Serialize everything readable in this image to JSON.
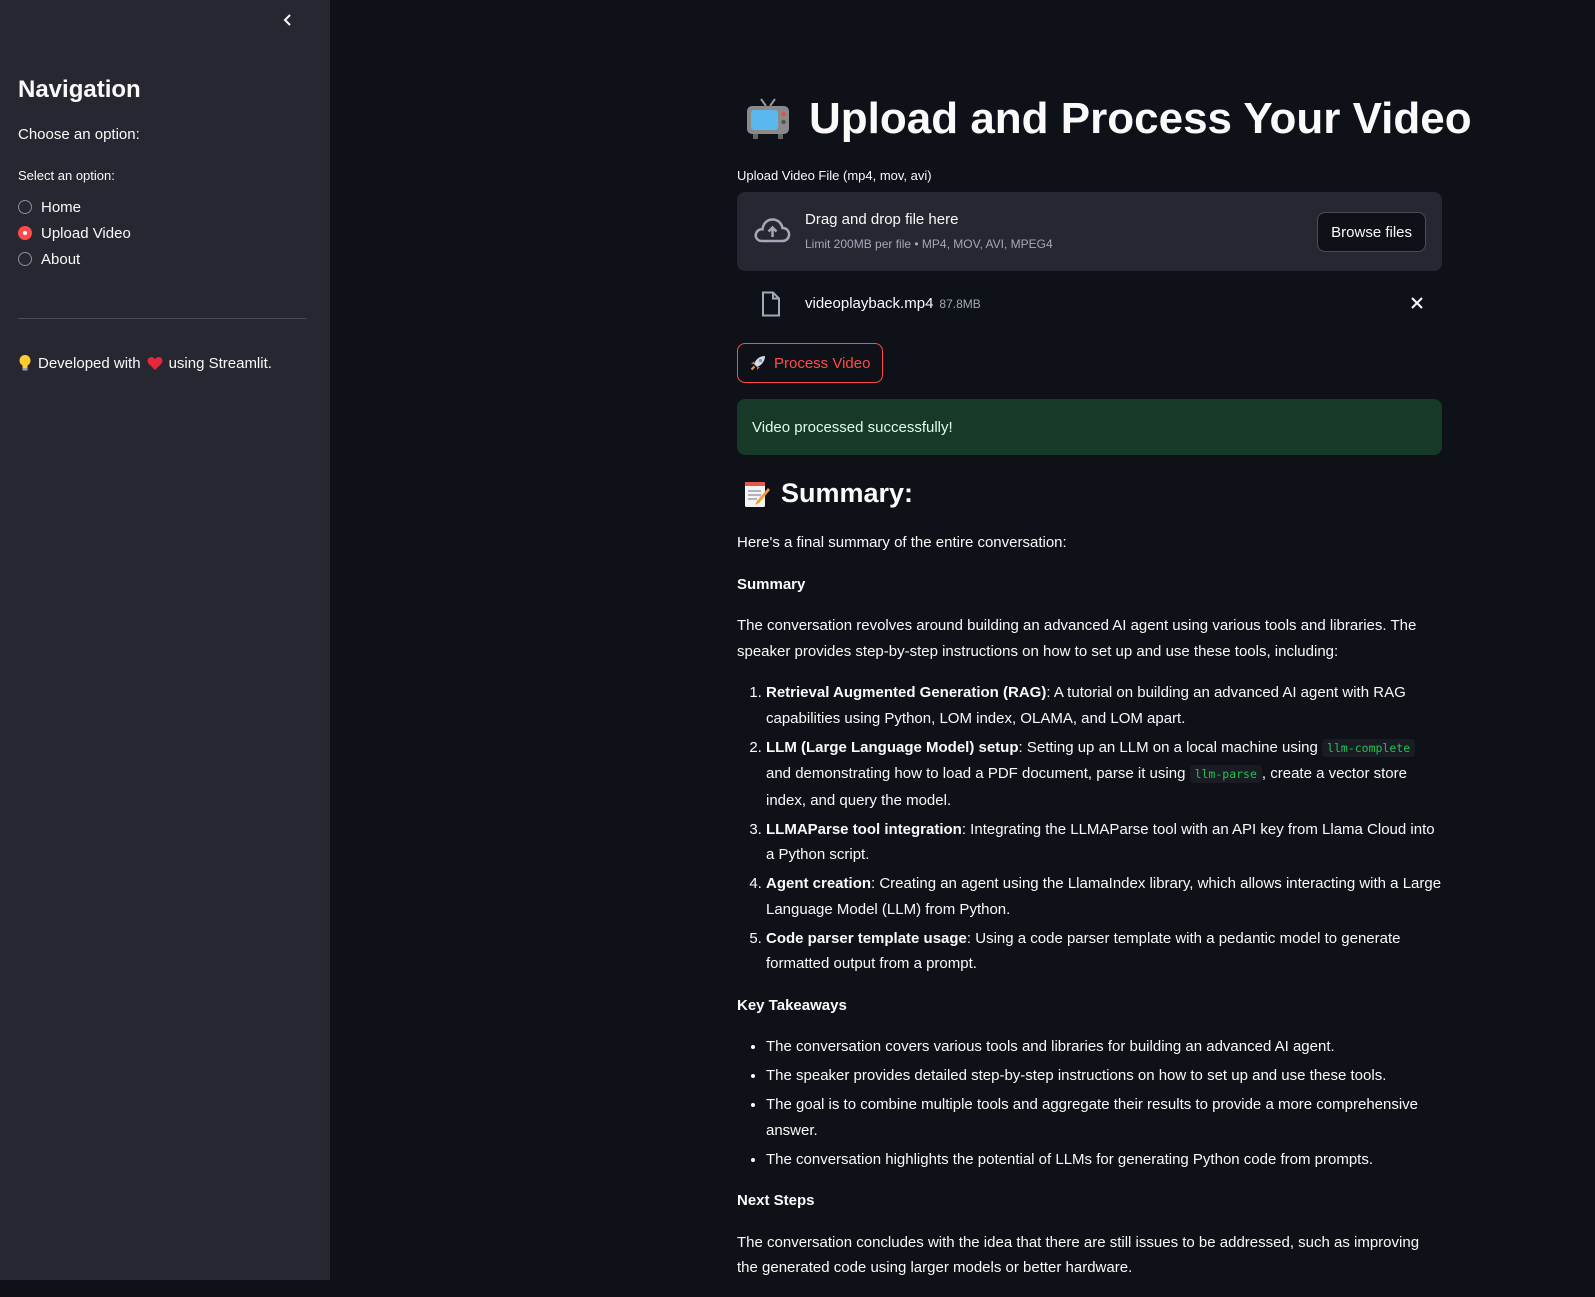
{
  "sidebar": {
    "title": "Navigation",
    "subtitle": "Choose an option:",
    "radio_label": "Select an option:",
    "options": [
      "Home",
      "Upload Video",
      "About"
    ],
    "selected": "Upload Video",
    "footer_prefix": "Developed with",
    "footer_suffix": "using Streamlit."
  },
  "main": {
    "title": "Upload and Process Your Video",
    "upload_label": "Upload Video File (mp4, mov, avi)",
    "dropzone": {
      "title": "Drag and drop file here",
      "limit": "Limit 200MB per file • MP4, MOV, AVI, MPEG4",
      "browse_label": "Browse files"
    },
    "file": {
      "name": "videoplayback.mp4",
      "size": "87.8MB"
    },
    "process_label": "Process Video",
    "success_message": "Video processed successfully!",
    "summary_heading": "Summary:",
    "intro": "Here's a final summary of the entire conversation:",
    "summary_label": "Summary",
    "summary_para": "The conversation revolves around building an advanced AI agent using various tools and libraries. The speaker provides step-by-step instructions on how to set up and use these tools, including:",
    "steps": [
      {
        "bold": "Retrieval Augmented Generation (RAG)",
        "text": ": A tutorial on building an advanced AI agent with RAG capabilities using Python, LOM index, OLAMA, and LOM apart."
      },
      {
        "bold": "LLM (Large Language Model) setup",
        "t1": ": Setting up an LLM on a local machine using ",
        "c1": "llm-complete",
        "t2": " and demonstrating how to load a PDF document, parse it using ",
        "c2": "llm-parse",
        "t3": ", create a vector store index, and query the model."
      },
      {
        "bold": "LLMAParse tool integration",
        "text": ": Integrating the LLMAParse tool with an API key from Llama Cloud into a Python script."
      },
      {
        "bold": "Agent creation",
        "text": ": Creating an agent using the LlamaIndex library, which allows interacting with a Large Language Model (LLM) from Python."
      },
      {
        "bold": "Code parser template usage",
        "text": ": Using a code parser template with a pedantic model to generate formatted output from a prompt."
      }
    ],
    "takeaways_label": "Key Takeaways",
    "takeaways": [
      "The conversation covers various tools and libraries for building an advanced AI agent.",
      "The speaker provides detailed step-by-step instructions on how to set up and use these tools.",
      "The goal is to combine multiple tools and aggregate their results to provide a more comprehensive answer.",
      "The conversation highlights the potential of LLMs for generating Python code from prompts."
    ],
    "next_label": "Next Steps",
    "next_para": "The conversation concludes with the idea that there are still issues to be addressed, such as improving the generated code using larger models or better hardware."
  }
}
